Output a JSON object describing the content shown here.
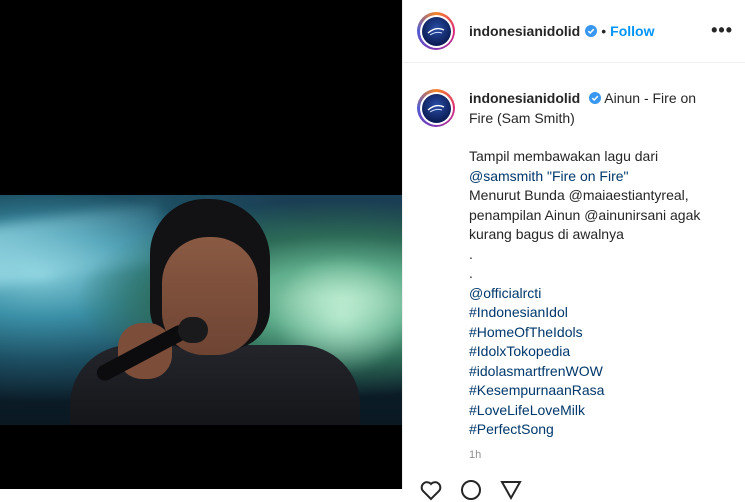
{
  "post": {
    "username": "indonesianidolid",
    "follow_label": "Follow",
    "separator": "•",
    "more_label": "•••",
    "caption_title": "Ainun - Fire on Fire (Sam Smith)",
    "caption_lines": [
      "Tampil membawakan lagu dari",
      "@samsmith \"Fire on Fire\"",
      "Menurut Bunda @maiaestiantyreal,",
      "penampilan Ainun @ainunirsani agak",
      "kurang bagus di awalnya",
      ".",
      ".",
      "@officialrcti",
      "#IndonesianIdol",
      "#HomeOfTheIdols",
      "#IdolxTokopedia",
      "#idolasmartfrenWOW",
      "#KesempurnaanRasa",
      "#LoveLifeLoveMilk",
      "#PerfectSong"
    ],
    "timestamp": "1h"
  },
  "icons": {
    "verified": "verified-badge-icon",
    "like": "heart-icon",
    "comment": "comment-icon",
    "share": "share-icon"
  },
  "colors": {
    "link": "#00376b",
    "follow": "#0095f6",
    "verified": "#3897f0"
  }
}
